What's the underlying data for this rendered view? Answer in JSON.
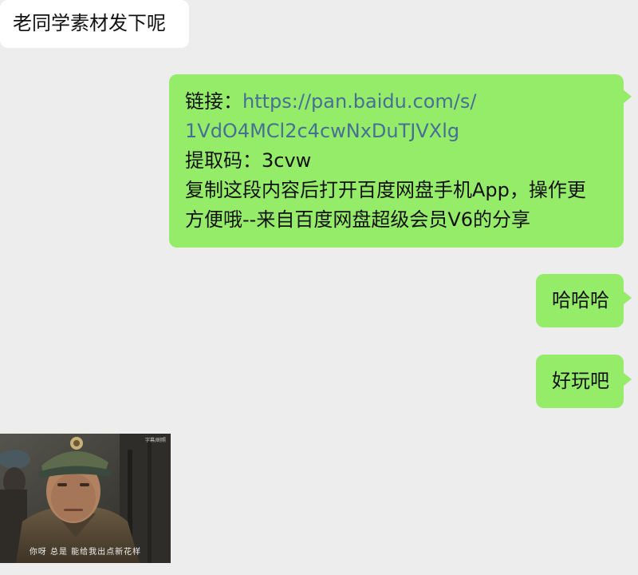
{
  "messages": {
    "incoming_text": "老同学素材发下呢",
    "share": {
      "link_label": "链接：",
      "link_part1": "https://pan.baidu.com/s/",
      "link_part2": "1VdO4MCl2c4cwNxDuTJVXlg",
      "code_line": "提取码：3cvw",
      "desc_line1": "复制这段内容后打开百度网盘手机App，操作更",
      "desc_line2": "方便哦--来自百度网盘超级会员V6的分享"
    },
    "haha": "哈哈哈",
    "fun": "好玩吧",
    "image": {
      "subtitle": "你呀  总是  能给我出点新花样",
      "watermark": "字幕/剧照",
      "description": "movie still: man in military officer cap and greatcoat in a trench"
    }
  },
  "colors": {
    "background": "#ededed",
    "outgoing_bubble": "#95ec69",
    "incoming_bubble": "#ffffff",
    "link": "#476f96"
  }
}
